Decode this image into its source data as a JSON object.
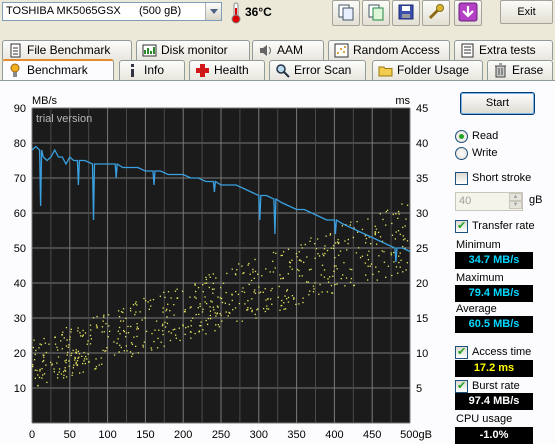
{
  "toolbar": {
    "drive": "TOSHIBA MK5065GSX",
    "drive_size": "(500 gB)",
    "temperature": "36°C",
    "exit_label": "Exit"
  },
  "tabs_row1": [
    "File Benchmark",
    "Disk monitor",
    "AAM",
    "Random Access",
    "Extra tests"
  ],
  "tabs_row2": [
    "Benchmark",
    "Info",
    "Health",
    "Error Scan",
    "Folder Usage",
    "Erase"
  ],
  "side": {
    "start_label": "Start",
    "read_label": "Read",
    "write_label": "Write",
    "short_stroke_label": "Short stroke",
    "short_stroke_value": "40",
    "short_stroke_unit": "gB",
    "transfer_rate_label": "Transfer rate",
    "minimum_label": "Minimum",
    "minimum_value": "34.7 MB/s",
    "maximum_label": "Maximum",
    "maximum_value": "79.4 MB/s",
    "average_label": "Average",
    "average_value": "60.5 MB/s",
    "access_time_label": "Access time",
    "access_time_value": "17.2 ms",
    "burst_rate_label": "Burst rate",
    "burst_rate_value": "97.4 MB/s",
    "cpu_usage_label": "CPU usage",
    "cpu_usage_value": "-1.0%"
  },
  "chart_data": {
    "type": "line",
    "watermark": "trial version",
    "ylabel_left": "MB/s",
    "ylabel_right": "ms",
    "xlabel": "gB",
    "y_left_ticks": [
      90,
      80,
      70,
      60,
      50,
      40,
      30,
      20,
      10
    ],
    "y_right_ticks": [
      45,
      40,
      35,
      30,
      25,
      20,
      15,
      10,
      5
    ],
    "x_ticks": [
      0,
      50,
      100,
      150,
      200,
      250,
      300,
      350,
      400,
      450,
      500
    ],
    "x_range": [
      0,
      500
    ],
    "y_left_range": [
      0,
      90
    ],
    "y_right_range": [
      0,
      45
    ],
    "grid": true,
    "colors": {
      "background": "#1b1b1b",
      "grid": "#7a7a7a",
      "transfer": "#3aa0e0",
      "access": "#e8e860",
      "text": "#ffffff"
    },
    "series": [
      {
        "name": "Transfer rate",
        "axis": "left",
        "x": [
          0,
          5,
          10,
          15,
          20,
          25,
          30,
          35,
          40,
          45,
          50,
          55,
          60,
          70,
          80,
          90,
          100,
          110,
          120,
          130,
          140,
          150,
          160,
          170,
          180,
          190,
          200,
          210,
          220,
          230,
          240,
          250,
          260,
          270,
          280,
          290,
          300,
          310,
          320,
          330,
          340,
          350,
          360,
          370,
          380,
          390,
          400,
          410,
          420,
          430,
          440,
          450,
          460,
          470,
          480,
          490,
          500
        ],
        "y": [
          78,
          79,
          78,
          76,
          75,
          76,
          78,
          76,
          76,
          74,
          76,
          75,
          75,
          75,
          74,
          74,
          74,
          74,
          73,
          73,
          73,
          72,
          72,
          72,
          71,
          71,
          71,
          70,
          70,
          69,
          69,
          68,
          68,
          68,
          67,
          66,
          65,
          65,
          64,
          63,
          62,
          61,
          61,
          60,
          59,
          58,
          58,
          57,
          56,
          55,
          54,
          53,
          52,
          51,
          50,
          50,
          49
        ]
      },
      {
        "name": "Access time",
        "axis": "right",
        "style": "scatter",
        "points_band": {
          "x_range": [
            0,
            500
          ],
          "low": [
            5,
            22
          ],
          "high": [
            12,
            32
          ]
        }
      }
    ]
  }
}
